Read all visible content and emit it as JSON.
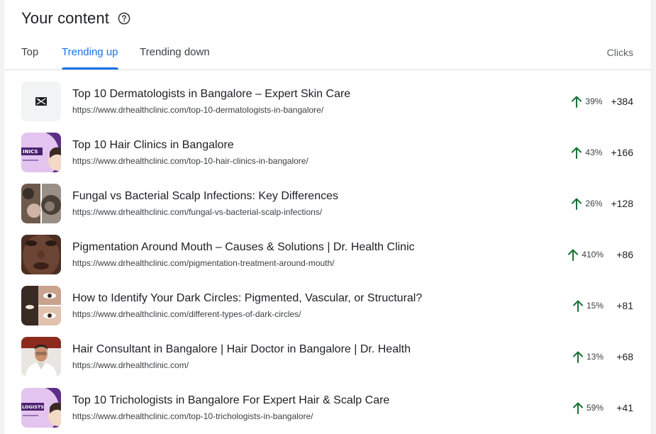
{
  "header": {
    "title": "Your content",
    "help_icon": "help-circle-icon"
  },
  "tabs": [
    {
      "label": "Top",
      "active": false
    },
    {
      "label": "Trending up",
      "active": true
    },
    {
      "label": "Trending down",
      "active": false
    }
  ],
  "columns": {
    "clicks": "Clicks"
  },
  "colors": {
    "accent": "#1a73e8",
    "trend_up": "#137333"
  },
  "rows": [
    {
      "title": "Top 10 Dermatologists in Bangalore – Expert Skin Care",
      "url": "https://www.drhealthclinic.com/top-10-dermatologists-in-bangalore/",
      "change_pct": "39%",
      "clicks_delta": "+384",
      "trend_icon": "arrow-up-icon",
      "thumb": "placeholder-icon"
    },
    {
      "title": "Top 10 Hair Clinics in Bangalore",
      "url": "https://www.drhealthclinic.com/top-10-hair-clinics-in-bangalore/",
      "change_pct": "43%",
      "clicks_delta": "+166",
      "trend_icon": "arrow-up-icon",
      "thumb": "purple-banner-thumbnail",
      "thumb_text": "INICS"
    },
    {
      "title": "Fungal vs Bacterial Scalp Infections: Key Differences",
      "url": "https://www.drhealthclinic.com/fungal-vs-bacterial-scalp-infections/",
      "change_pct": "26%",
      "clicks_delta": "+128",
      "trend_icon": "arrow-up-icon",
      "thumb": "scalp-photo-thumbnail"
    },
    {
      "title": "Pigmentation Around Mouth – Causes & Solutions | Dr. Health Clinic",
      "url": "https://www.drhealthclinic.com/pigmentation-treatment-around-mouth/",
      "change_pct": "410%",
      "clicks_delta": "+86",
      "trend_icon": "arrow-up-icon",
      "thumb": "face-photo-thumbnail"
    },
    {
      "title": "How to Identify Your Dark Circles: Pigmented, Vascular, or Structural?",
      "url": "https://www.drhealthclinic.com/different-types-of-dark-circles/",
      "change_pct": "15%",
      "clicks_delta": "+81",
      "trend_icon": "arrow-up-icon",
      "thumb": "eyes-photo-thumbnail"
    },
    {
      "title": "Hair Consultant in Bangalore | Hair Doctor in Bangalore | Dr. Health",
      "url": "https://www.drhealthclinic.com/",
      "change_pct": "13%",
      "clicks_delta": "+68",
      "trend_icon": "arrow-up-icon",
      "thumb": "doctor-photo-thumbnail"
    },
    {
      "title": "Top 10 Trichologists in Bangalore For Expert Hair & Scalp Care",
      "url": "https://www.drhealthclinic.com/top-10-trichologists-in-bangalore/",
      "change_pct": "59%",
      "clicks_delta": "+41",
      "trend_icon": "arrow-up-icon",
      "thumb": "purple-banner-thumbnail",
      "thumb_text": "LOGISTS"
    }
  ]
}
